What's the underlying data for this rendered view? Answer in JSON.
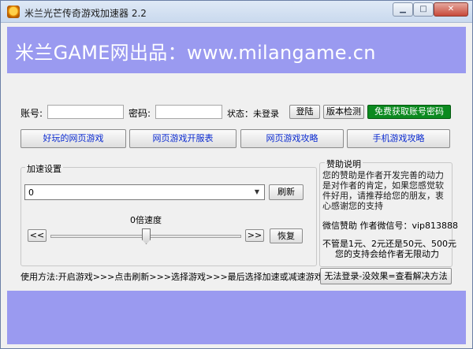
{
  "window": {
    "title": "米兰光芒传奇游戏加速器 2.2",
    "minimize_icon": "minimize-icon",
    "maximize_icon": "maximize-icon",
    "close_icon": "close-icon"
  },
  "banner": {
    "text": "米兰GAME网出品：www.milangame.cn",
    "color": "#9a9af0"
  },
  "login": {
    "account_label": "账号:",
    "account_value": "",
    "password_label": "密码:",
    "password_value": "",
    "status_label": "状态：未登录",
    "login_button": "登陆",
    "version_button": "版本检测",
    "free_account_button": "免费获取账号密码",
    "free_account_color": "#0b8a1f"
  },
  "links": [
    "好玩的网页游戏",
    "网页游戏开服表",
    "网页游戏攻略",
    "手机游戏攻略"
  ],
  "speed": {
    "group_title": "加速设置",
    "process_value": "0",
    "refresh_button": "刷新",
    "speed_label": "0倍速度",
    "slower_button": "<<",
    "faster_button": ">>",
    "reset_button": "恢复",
    "slider_level": 0.5,
    "instructions": "使用方法:开启游戏>>>点击刷新>>>选择游戏>>>最后选择加速或减速游戏即可"
  },
  "help": {
    "group_title": "赞助说明",
    "text": "您的赞助是作者开发完善的动力是对作者的肯定，如果您感觉软件好用，请推荐给您的朋友，衷心感谢您的支持",
    "wechat": "微信赞助 作者微信号：vip813888",
    "donate_line1": "不管是1元、2元还是50元、500元",
    "donate_line2": "您的支持会给作者无限动力",
    "cannot_login_button": "无法登录-没效果=查看解决方法"
  }
}
